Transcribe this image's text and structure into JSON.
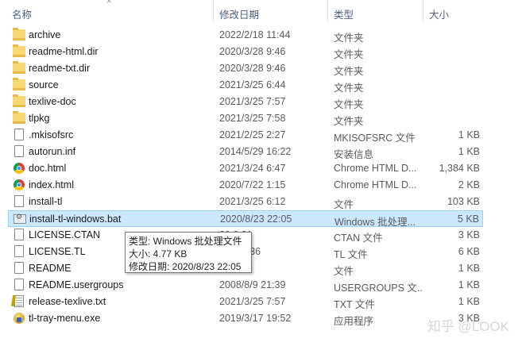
{
  "columns": {
    "name": "名称",
    "date": "修改日期",
    "type": "类型",
    "size": "大小"
  },
  "sort_indicator": "^",
  "files": [
    {
      "icon": "folder-icon",
      "name": "archive",
      "date": "2022/2/18 11:44",
      "type": "文件夹",
      "size": ""
    },
    {
      "icon": "folder-icon",
      "name": "readme-html.dir",
      "date": "2020/3/28 9:46",
      "type": "文件夹",
      "size": ""
    },
    {
      "icon": "folder-icon",
      "name": "readme-txt.dir",
      "date": "2020/3/28 9:46",
      "type": "文件夹",
      "size": ""
    },
    {
      "icon": "folder-icon",
      "name": "source",
      "date": "2021/3/25 6:44",
      "type": "文件夹",
      "size": ""
    },
    {
      "icon": "folder-icon",
      "name": "texlive-doc",
      "date": "2021/3/25 7:57",
      "type": "文件夹",
      "size": ""
    },
    {
      "icon": "folder-icon",
      "name": "tlpkg",
      "date": "2021/3/25 7:58",
      "type": "文件夹",
      "size": ""
    },
    {
      "icon": "file-icon",
      "name": ".mkisofsrc",
      "date": "2021/2/25 2:27",
      "type": "MKISOFSRC 文件",
      "size": "1 KB"
    },
    {
      "icon": "settings-file-icon",
      "name": "autorun.inf",
      "date": "2014/5/29 16:22",
      "type": "安装信息",
      "size": "1 KB"
    },
    {
      "icon": "chrome-icon",
      "name": "doc.html",
      "date": "2021/3/24 6:47",
      "type": "Chrome HTML D...",
      "size": "1,384 KB"
    },
    {
      "icon": "chrome-icon",
      "name": "index.html",
      "date": "2020/7/22 1:15",
      "type": "Chrome HTML D...",
      "size": "2 KB"
    },
    {
      "icon": "file-icon",
      "name": "install-tl",
      "date": "2021/3/25 6:12",
      "type": "文件",
      "size": "103 KB"
    },
    {
      "icon": "batch-file-icon",
      "name": "install-tl-windows.bat",
      "date": "2020/8/23 22:05",
      "type": "Windows 批处理...",
      "size": "5 KB",
      "selected": true
    },
    {
      "icon": "file-icon",
      "name": "LICENSE.CTAN",
      "date": "29 0:31",
      "type": "CTAN 文件",
      "size": "3 KB"
    },
    {
      "icon": "file-icon",
      "name": "LICENSE.TL",
      "date": "/20 10:36",
      "type": "TL 文件",
      "size": "6 KB"
    },
    {
      "icon": "file-icon",
      "name": "README",
      "date": "8 22:35",
      "type": "文件",
      "size": "1 KB"
    },
    {
      "icon": "file-icon",
      "name": "README.usergroups",
      "date": "2008/8/9 21:39",
      "type": "USERGROUPS 文...",
      "size": "1 KB"
    },
    {
      "icon": "text-file-icon",
      "name": "release-texlive.txt",
      "date": "2021/3/25 7:57",
      "type": "TXT 文件",
      "size": "1 KB"
    },
    {
      "icon": "exe-icon",
      "name": "tl-tray-menu.exe",
      "date": "2019/3/17 19:52",
      "type": "应用程序",
      "size": "3 KB"
    }
  ],
  "tooltip": {
    "type_line": "类型: Windows 批处理文件",
    "size_line": "大小: 4.77 KB",
    "date_line": "修改日期: 2020/8/23 22:05"
  },
  "watermark": "知乎 @LOOK",
  "colors": {
    "header_text": "#4d6082",
    "selection_bg": "#cce8ff",
    "selection_border": "#99d1ff"
  }
}
